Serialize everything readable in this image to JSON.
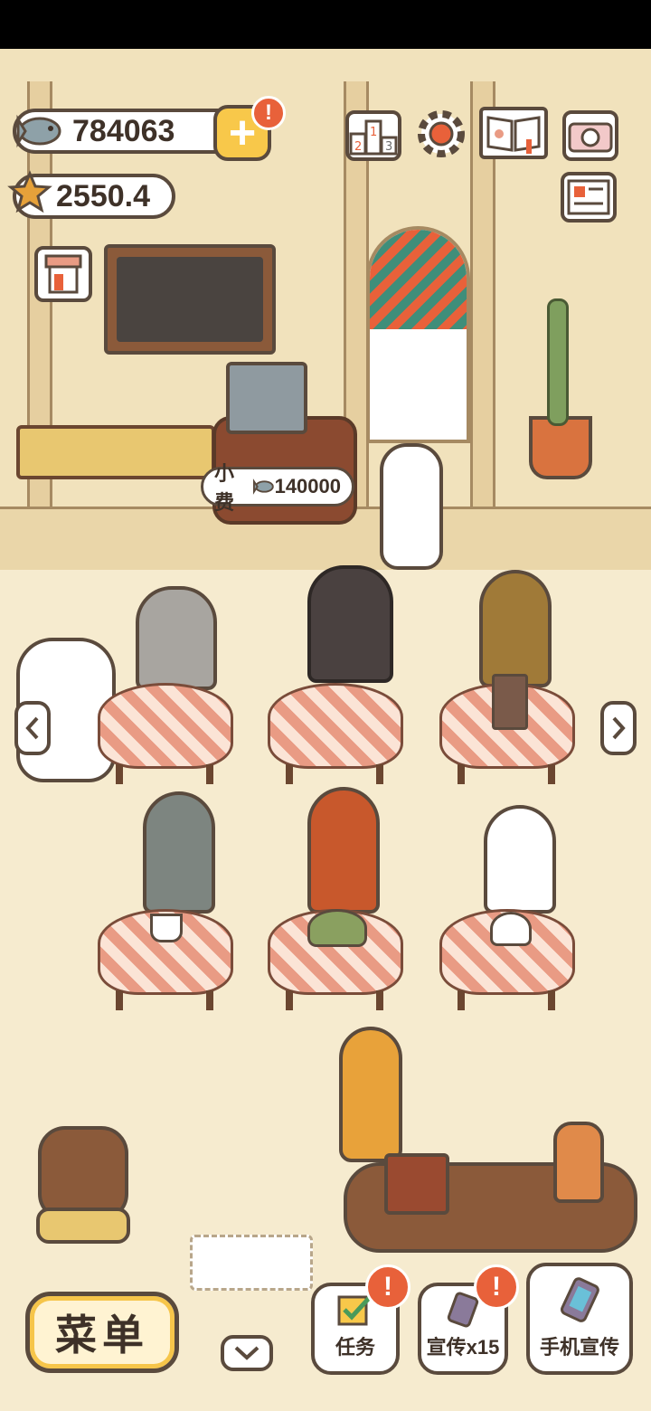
{
  "hud": {
    "fish_count": "784063",
    "star_count": "2550.4",
    "alert_mark": "!"
  },
  "tip_bubble": {
    "label": "小费",
    "amount": "140000"
  },
  "bottom_bar": {
    "menu_label": "菜单",
    "tasks_label": "任务",
    "promote_label": "宣传x15",
    "phone_promote_label": "手机宣传",
    "alert_mark": "!"
  },
  "icons": {
    "fish": "fish-icon",
    "star": "star-icon",
    "plus": "plus-icon",
    "ranking": "ranking-podium-icon",
    "settings": "gear-icon",
    "recipe_book": "book-icon",
    "camera": "camera-icon",
    "news": "newspaper-icon",
    "shop": "shop-icon",
    "arrow_left": "chevron-left-icon",
    "arrow_right": "chevron-right-icon",
    "arrow_down": "chevron-down-icon"
  },
  "colors": {
    "accent_yellow": "#f8c84a",
    "alert_orange": "#e8613a",
    "outline": "#5a4a3d"
  }
}
